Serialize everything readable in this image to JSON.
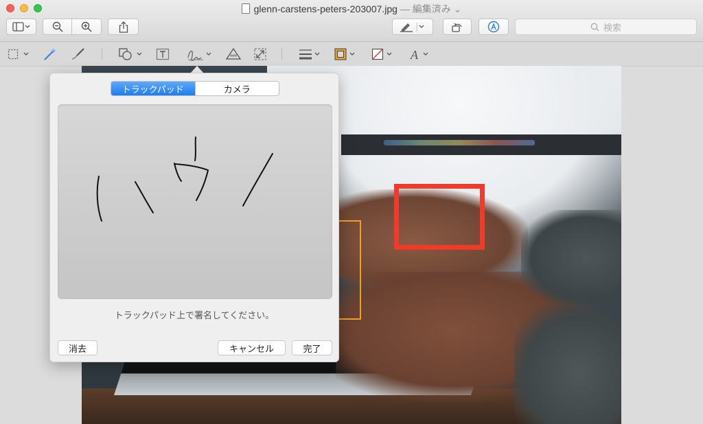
{
  "window": {
    "title": "glenn-carstens-peters-203007.jpg",
    "title_suffix": "— 編集済み",
    "traffic_lights": {
      "close": "#fc605b",
      "minimize": "#fdbc40",
      "zoom": "#34c84a"
    }
  },
  "toolbar": {
    "search_placeholder": "検索",
    "buttons": [
      "sidebar-view-icon",
      "zoom-out-icon",
      "zoom-in-icon",
      "share-icon",
      "highlight-icon",
      "rotate-icon",
      "markup-icon"
    ]
  },
  "markup_toolbar": {
    "tools": [
      "selection-icon",
      "instant-alpha-icon",
      "sketch-icon",
      "shapes-icon",
      "text-icon",
      "sign-icon",
      "adjust-color-icon",
      "adjust-size-icon",
      "line-style-icon",
      "border-color-icon",
      "fill-color-icon",
      "text-style-icon"
    ]
  },
  "signature_popover": {
    "tabs": [
      {
        "label": "トラックパッド",
        "active": true
      },
      {
        "label": "カメラ",
        "active": false
      }
    ],
    "instructions": "トラックパッド上で署名してください。",
    "clear_label": "消去",
    "cancel_label": "キャンセル",
    "done_label": "完了",
    "accent_color": "#1d7cf2"
  },
  "annotations": {
    "red_rectangle_color": "#f23a2a",
    "orange_rectangle_color": "#f0a21e"
  }
}
